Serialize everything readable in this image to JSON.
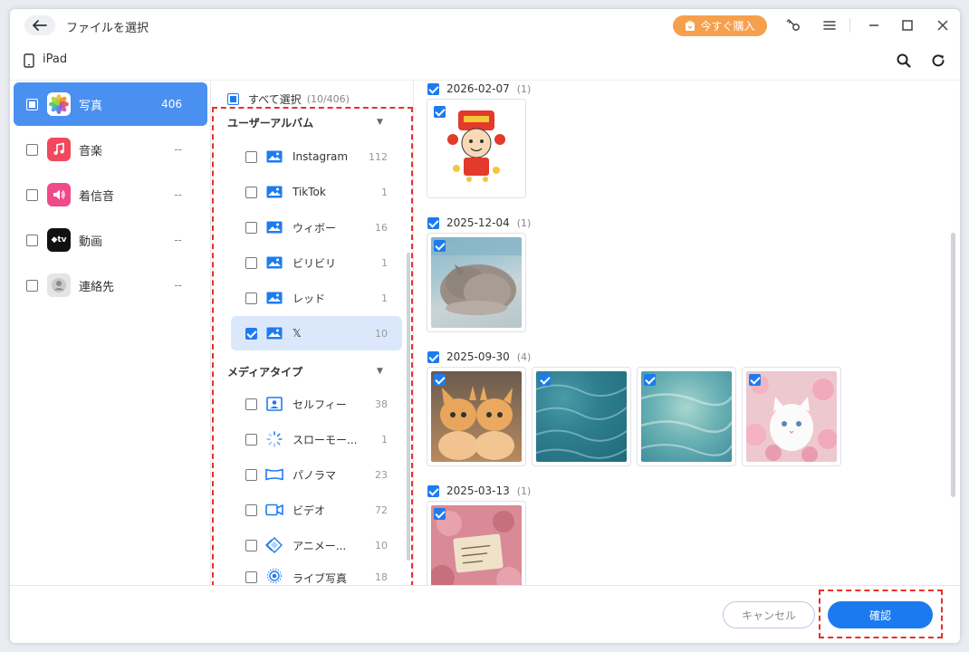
{
  "window": {
    "title": "ファイルを選択",
    "buy_label": "今すぐ購入",
    "device_name": "iPad"
  },
  "categories": [
    {
      "label": "写真",
      "count": "406",
      "icon": "photos-app-icon",
      "active": true
    },
    {
      "label": "音楽",
      "count": "--",
      "icon": "music-app-icon"
    },
    {
      "label": "着信音",
      "count": "--",
      "icon": "ringtone-app-icon"
    },
    {
      "label": "動画",
      "count": "--",
      "icon": "apple-tv-app-icon"
    },
    {
      "label": "連絡先",
      "count": "--",
      "icon": "contacts-app-icon"
    }
  ],
  "select_all": {
    "label": "すべて選択",
    "count": "(10/406)"
  },
  "user_albums": {
    "title": "ユーザーアルバム",
    "items": [
      {
        "label": "Instagram",
        "count": "112"
      },
      {
        "label": "TikTok",
        "count": "1"
      },
      {
        "label": "ウィボー",
        "count": "16"
      },
      {
        "label": "ビリビリ",
        "count": "1"
      },
      {
        "label": "レッド",
        "count": "1"
      },
      {
        "label": "𝕏",
        "count": "10",
        "checked": true
      }
    ]
  },
  "media_types": {
    "title": "メディアタイプ",
    "items": [
      {
        "label": "セルフィー",
        "count": "38",
        "icon": "selfie-icon"
      },
      {
        "label": "スローモー...",
        "count": "1",
        "icon": "slow-motion-icon"
      },
      {
        "label": "パノラマ",
        "count": "23",
        "icon": "panorama-icon"
      },
      {
        "label": "ビデオ",
        "count": "72",
        "icon": "video-icon"
      },
      {
        "label": "アニメー...",
        "count": "10",
        "icon": "animation-icon"
      },
      {
        "label": "ライブ写真",
        "count": "18",
        "icon": "live-photo-icon"
      }
    ]
  },
  "photo_groups": [
    {
      "date": "2026-02-07",
      "count": "(1)"
    },
    {
      "date": "2025-12-04",
      "count": "(1)"
    },
    {
      "date": "2025-09-30",
      "count": "(4)"
    },
    {
      "date": "2025-03-13",
      "count": "(1)"
    }
  ],
  "footer": {
    "cancel_label": "キャンセル",
    "confirm_label": "確認"
  },
  "colors": {
    "accent": "#1c7af0",
    "active_category": "#4a90f0",
    "buy_button": "#f6a04d",
    "highlight_dash": "#e5312b"
  }
}
